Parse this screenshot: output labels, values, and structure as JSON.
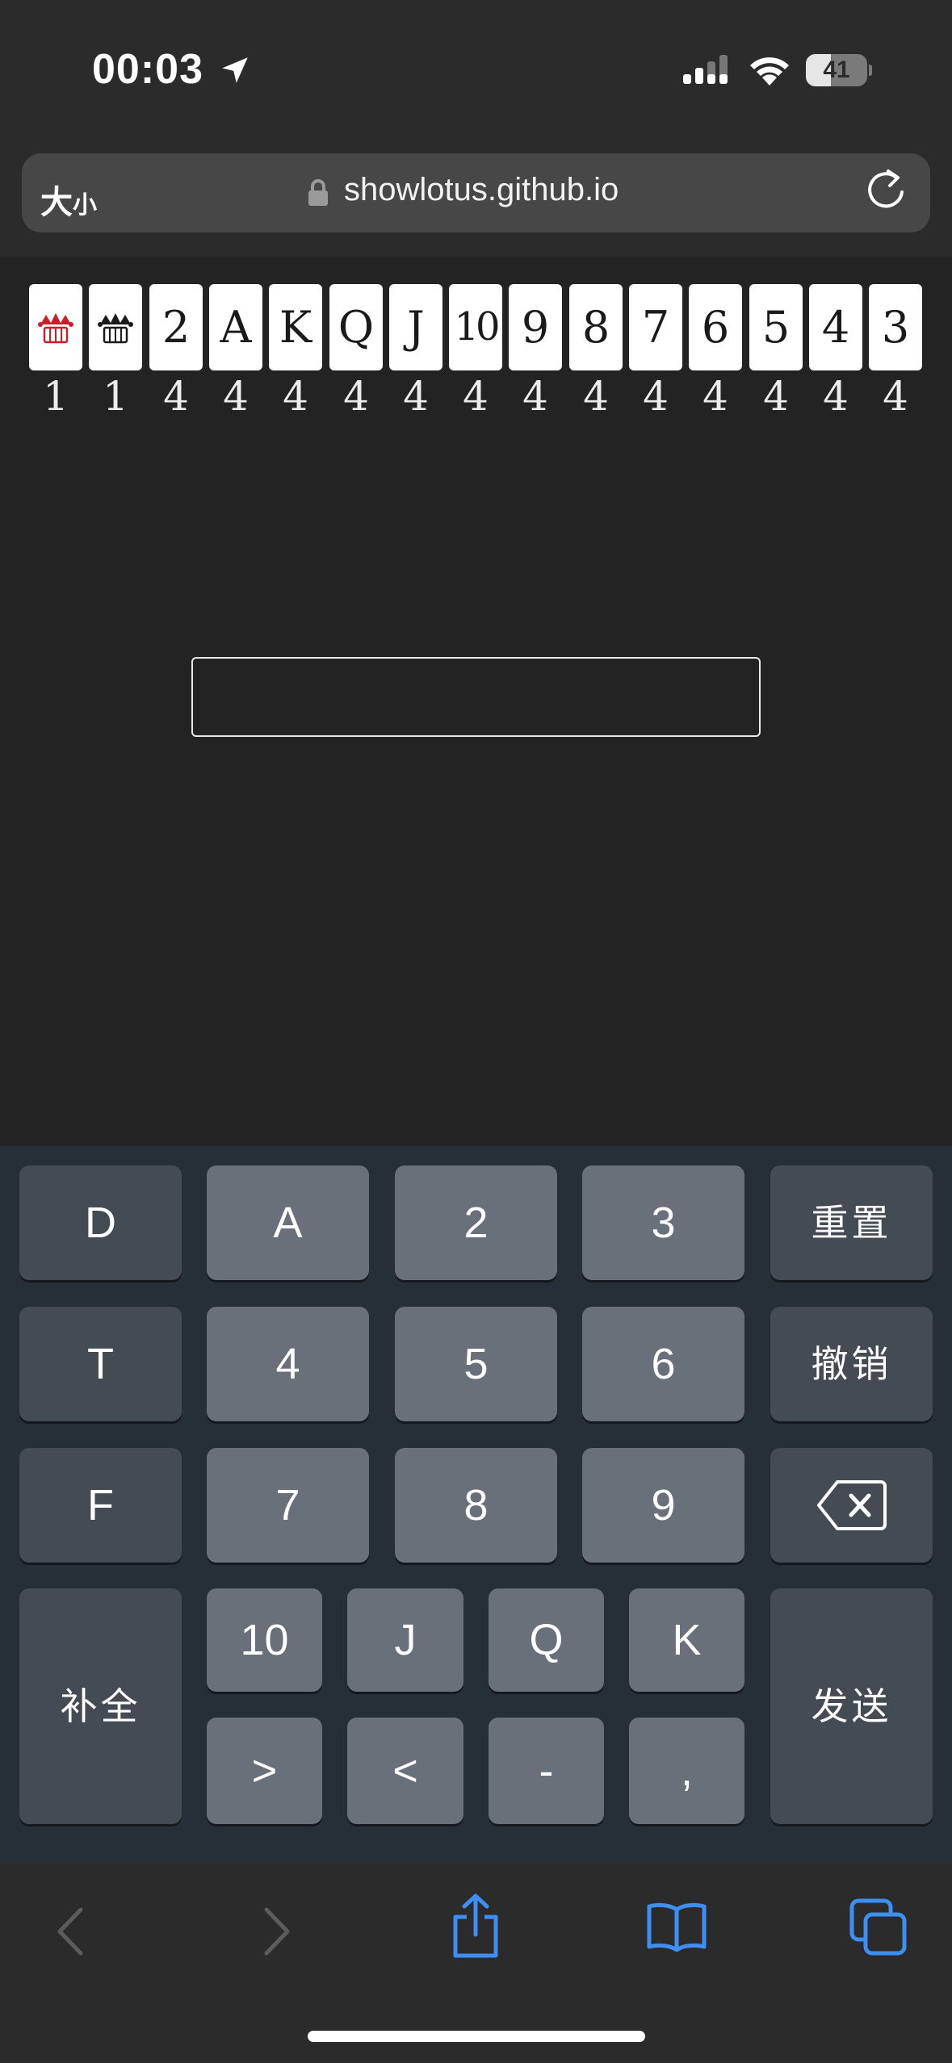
{
  "status_bar": {
    "time": "00:03",
    "battery": "41",
    "battery_level": 0.41
  },
  "address_bar": {
    "size_label_big": "大",
    "size_label_small": "小",
    "url": "showlotus.github.io"
  },
  "cards": [
    {
      "rank": "",
      "icon": "red-joker-icon",
      "count": "1"
    },
    {
      "rank": "",
      "icon": "black-joker-icon",
      "count": "1"
    },
    {
      "rank": "2",
      "count": "4"
    },
    {
      "rank": "A",
      "count": "4"
    },
    {
      "rank": "K",
      "count": "4"
    },
    {
      "rank": "Q",
      "count": "4"
    },
    {
      "rank": "J",
      "count": "4"
    },
    {
      "rank": "10",
      "count": "4"
    },
    {
      "rank": "9",
      "count": "4"
    },
    {
      "rank": "8",
      "count": "4"
    },
    {
      "rank": "7",
      "count": "4"
    },
    {
      "rank": "6",
      "count": "4"
    },
    {
      "rank": "5",
      "count": "4"
    },
    {
      "rank": "4",
      "count": "4"
    },
    {
      "rank": "3",
      "count": "4"
    }
  ],
  "input": {
    "value": ""
  },
  "keyboard": {
    "row1": [
      "D",
      "A",
      "2",
      "3",
      "重置"
    ],
    "row2": [
      "T",
      "4",
      "5",
      "6",
      "撤销"
    ],
    "row3": [
      "F",
      "7",
      "8",
      "9",
      "delete"
    ],
    "fill_all": "补全",
    "send": "发送",
    "row4": [
      "10",
      "J",
      "Q",
      "K"
    ],
    "row5": [
      ">",
      "<",
      "-",
      ","
    ]
  },
  "colors": {
    "accent": "#3d8ef5",
    "joker_red": "#c8202a",
    "keyboard_bg": "#262e37"
  }
}
